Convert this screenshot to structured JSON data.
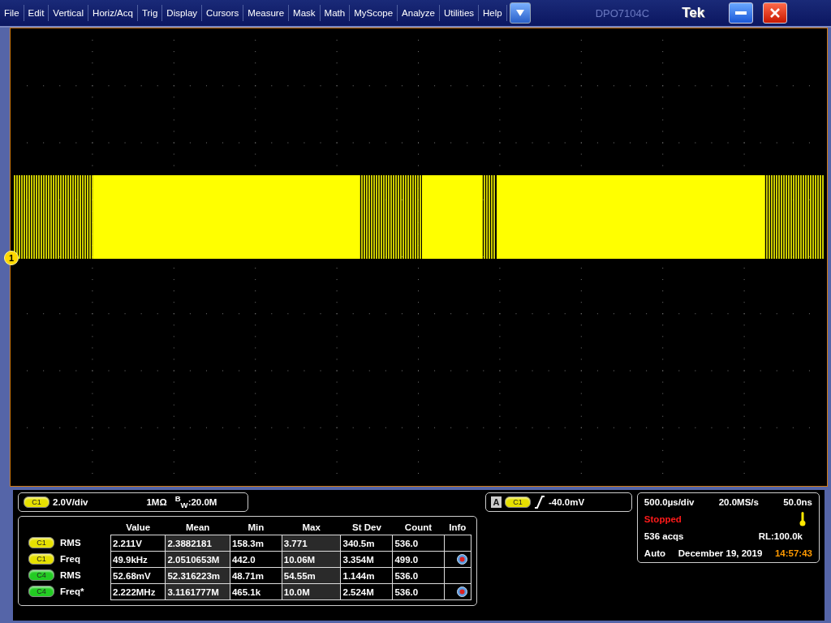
{
  "menu": [
    "File",
    "Edit",
    "Vertical",
    "Horiz/Acq",
    "Trig",
    "Display",
    "Cursors",
    "Measure",
    "Mask",
    "Math",
    "MyScope",
    "Analyze",
    "Utilities",
    "Help"
  ],
  "model": "DPO7104C",
  "brand": "Tek",
  "channel_marker": "1",
  "vertical": {
    "channel": "C1",
    "color": "#e6e000",
    "scale": "2.0V/div",
    "impedance": "1MΩ",
    "bandwidth": "$^{B}$$_{W}$:20.0M"
  },
  "trigger": {
    "source": "A",
    "channel": "C1",
    "color": "#e6e000",
    "level": "-40.0mV"
  },
  "measurements": {
    "columns": [
      "Value",
      "Mean",
      "Min",
      "Max",
      "St Dev",
      "Count",
      "Info"
    ],
    "rows": [
      {
        "channel": "C1",
        "color": "#e6e000",
        "name": "RMS",
        "cells": [
          "2.211V",
          "2.3882181",
          "158.3m",
          "3.771",
          "340.5m",
          "536.0"
        ],
        "info": false
      },
      {
        "channel": "C1",
        "color": "#e6e000",
        "name": "Freq",
        "cells": [
          "49.9kHz",
          "2.0510653M",
          "442.0",
          "10.06M",
          "3.354M",
          "499.0"
        ],
        "info": true
      },
      {
        "channel": "C4",
        "color": "#22cc22",
        "name": "RMS",
        "cells": [
          "52.68mV",
          "52.316223m",
          "48.71m",
          "54.55m",
          "1.144m",
          "536.0"
        ],
        "info": false
      },
      {
        "channel": "C4",
        "color": "#22cc22",
        "name": "Freq*",
        "cells": [
          "2.222MHz",
          "3.1161777M",
          "465.1k",
          "10.0M",
          "2.524M",
          "536.0"
        ],
        "info": true
      }
    ]
  },
  "acquisition": {
    "scale": "500.0µs/div",
    "sample_rate": "20.0MS/s",
    "resolution": "50.0ns",
    "state": "Stopped",
    "acqs": "536 acqs",
    "record_length": "RL:100.0k",
    "mode": "Auto",
    "date": "December 19, 2019",
    "time": "14:57:43"
  }
}
